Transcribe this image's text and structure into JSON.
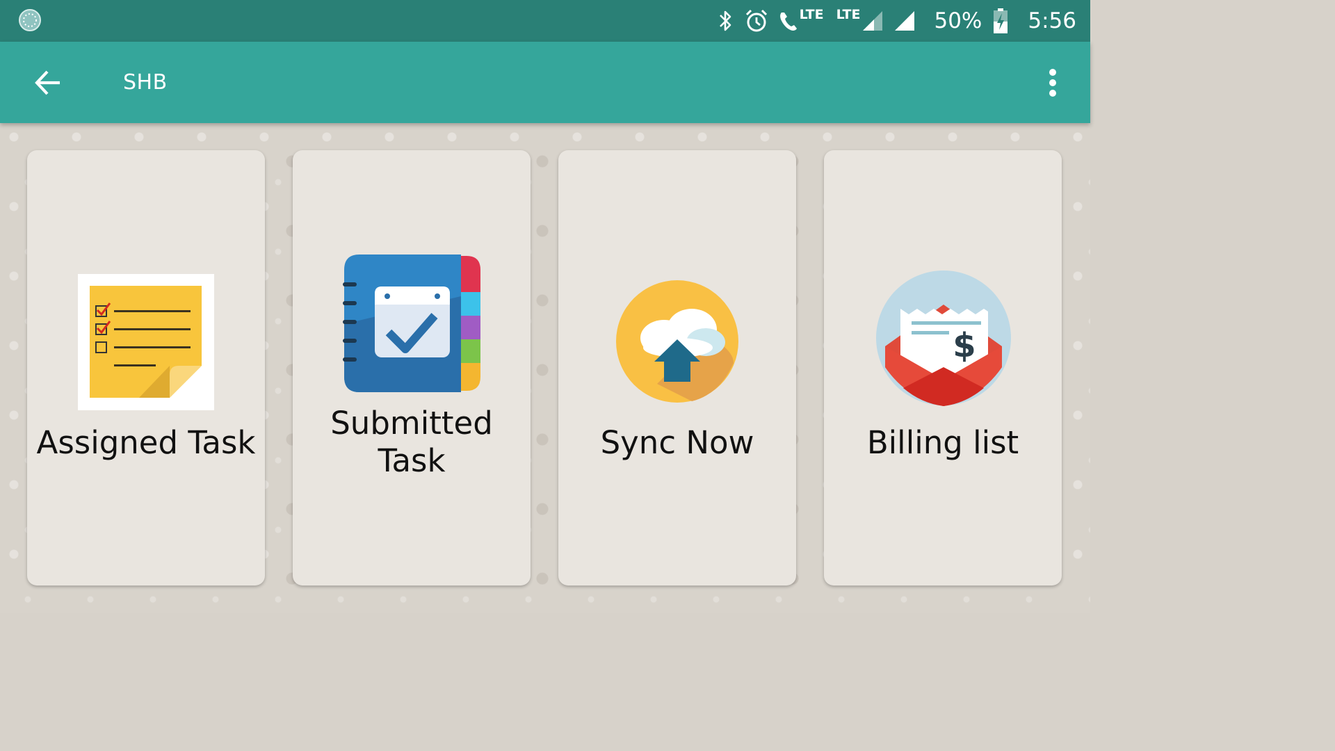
{
  "status_bar": {
    "lte_call_label": "LTE",
    "lte_label": "LTE",
    "battery_percent": "50%",
    "time": "5:56"
  },
  "app_bar": {
    "title": "SHB",
    "back_icon": "arrow-left-icon",
    "menu_icon": "more-vert-icon"
  },
  "cards": [
    {
      "label": "Assigned Task",
      "icon": "sticky-note-checklist-icon"
    },
    {
      "label": "Submitted Task",
      "icon": "calendar-notebook-check-icon"
    },
    {
      "label": "Sync Now",
      "icon": "cloud-upload-icon"
    },
    {
      "label": "Billing list",
      "icon": "envelope-bill-icon"
    }
  ],
  "colors": {
    "status_bar": "#2a8076",
    "app_bar": "#35a69b",
    "card": "#e9e5df"
  }
}
